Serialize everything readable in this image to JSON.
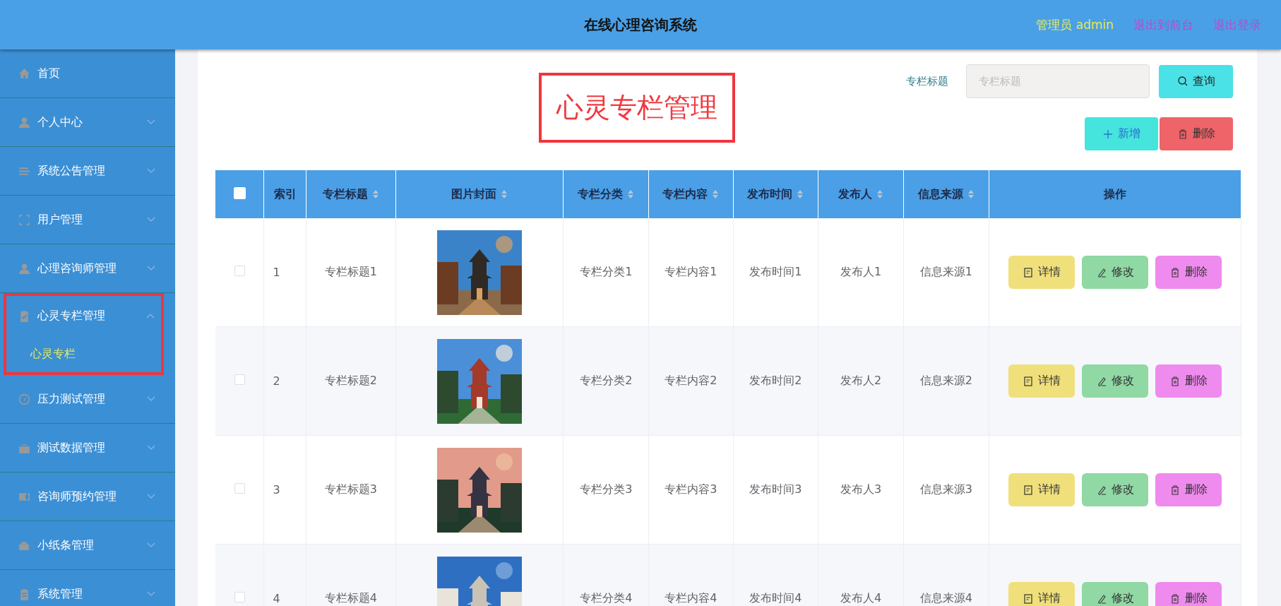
{
  "header": {
    "title": "在线心理咨询系统",
    "user": "管理员 admin",
    "links": [
      "退出到前台",
      "退出登录"
    ]
  },
  "sidebar": {
    "items": [
      {
        "label": "首页",
        "kind": "link"
      },
      {
        "label": "个人中心",
        "kind": "menu",
        "expanded": false,
        "highlighted": false
      },
      {
        "label": "系统公告管理",
        "kind": "menu",
        "expanded": false,
        "highlighted": false
      },
      {
        "label": "用户管理",
        "kind": "menu",
        "expanded": false,
        "highlighted": false
      },
      {
        "label": "心理咨询师管理",
        "kind": "menu",
        "expanded": false,
        "highlighted": false
      },
      {
        "label": "心灵专栏管理",
        "kind": "menu",
        "expanded": true,
        "highlighted": true,
        "children": [
          {
            "label": "心灵专栏",
            "selected": true
          }
        ]
      },
      {
        "label": "压力测试管理",
        "kind": "menu",
        "expanded": false,
        "highlighted": false
      },
      {
        "label": "测试数据管理",
        "kind": "menu",
        "expanded": false,
        "highlighted": false
      },
      {
        "label": "咨询师预约管理",
        "kind": "menu",
        "expanded": false,
        "highlighted": false
      },
      {
        "label": "小纸条管理",
        "kind": "menu",
        "expanded": false,
        "highlighted": false
      },
      {
        "label": "系统管理",
        "kind": "menu",
        "expanded": false,
        "highlighted": false
      }
    ]
  },
  "page_title": {
    "text": "心灵专栏管理",
    "highlighted": true
  },
  "search": {
    "label": "专栏标题",
    "placeholder": "专栏标题",
    "button": "查询"
  },
  "toolbar": [
    {
      "label": "新增",
      "kind": "add"
    },
    {
      "label": "删除",
      "kind": "delete"
    }
  ],
  "table": {
    "select_all": {
      "checked": false
    },
    "columns": [
      {
        "label": "索引",
        "sortable": false
      },
      {
        "label": "专栏标题",
        "sortable": true
      },
      {
        "label": "图片封面",
        "sortable": true
      },
      {
        "label": "专栏分类",
        "sortable": true
      },
      {
        "label": "专栏内容",
        "sortable": true
      },
      {
        "label": "发布时间",
        "sortable": true
      },
      {
        "label": "发布人",
        "sortable": true
      },
      {
        "label": "信息来源",
        "sortable": true
      },
      {
        "label": "操作",
        "sortable": false
      }
    ],
    "rows": [
      {
        "checked": false,
        "index": "1",
        "title": "专栏标题1",
        "image": {
          "kind": "picture"
        },
        "category": "专栏分类1",
        "content": "专栏内容1",
        "time": "发布时间1",
        "author": "发布人1",
        "source": "信息来源1",
        "actions": [
          {
            "label": "详情",
            "kind": "detail"
          },
          {
            "label": "修改",
            "kind": "edit"
          },
          {
            "label": "删除",
            "kind": "delete"
          }
        ]
      },
      {
        "checked": false,
        "index": "2",
        "title": "专栏标题2",
        "image": {
          "kind": "picture"
        },
        "category": "专栏分类2",
        "content": "专栏内容2",
        "time": "发布时间2",
        "author": "发布人2",
        "source": "信息来源2",
        "actions": [
          {
            "label": "详情",
            "kind": "detail"
          },
          {
            "label": "修改",
            "kind": "edit"
          },
          {
            "label": "删除",
            "kind": "delete"
          }
        ]
      },
      {
        "checked": false,
        "index": "3",
        "title": "专栏标题3",
        "image": {
          "kind": "picture"
        },
        "category": "专栏分类3",
        "content": "专栏内容3",
        "time": "发布时间3",
        "author": "发布人3",
        "source": "信息来源3",
        "actions": [
          {
            "label": "详情",
            "kind": "detail"
          },
          {
            "label": "修改",
            "kind": "edit"
          },
          {
            "label": "删除",
            "kind": "delete"
          }
        ]
      },
      {
        "checked": false,
        "index": "4",
        "title": "专栏标题4",
        "image": {
          "kind": "picture"
        },
        "category": "专栏分类4",
        "content": "专栏内容4",
        "time": "发布时间4",
        "author": "发布人4",
        "source": "信息来源4",
        "actions": [
          {
            "label": "详情",
            "kind": "detail"
          },
          {
            "label": "修改",
            "kind": "edit"
          },
          {
            "label": "删除",
            "kind": "delete"
          }
        ]
      }
    ]
  }
}
